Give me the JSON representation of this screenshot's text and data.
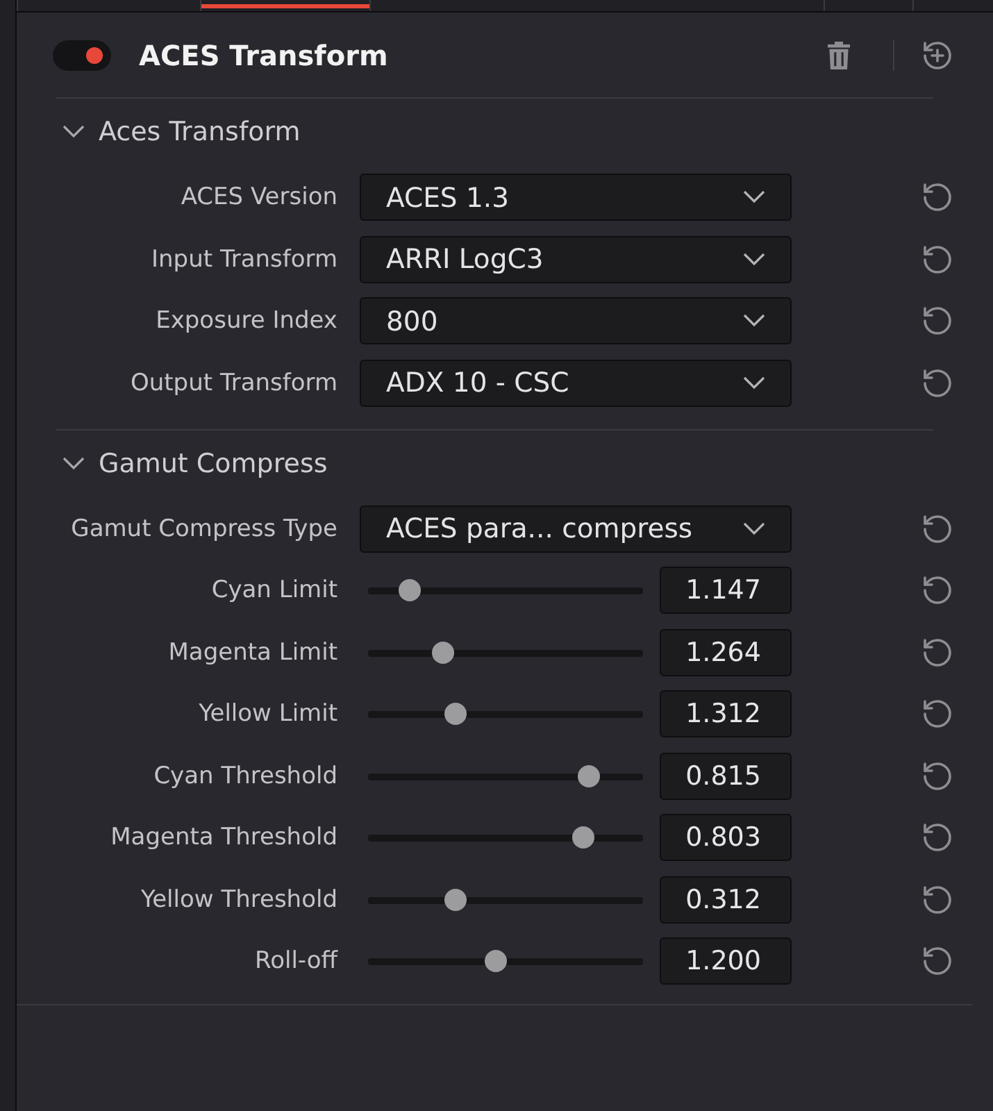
{
  "tab_bar": {
    "tabs": [
      {
        "selected": false
      },
      {
        "selected": true
      },
      {
        "selected": false
      },
      {
        "selected": false
      },
      {
        "selected": false
      }
    ]
  },
  "node": {
    "enabled": true,
    "title": "ACES Transform"
  },
  "sections": [
    {
      "title": "Aces Transform",
      "expanded": true,
      "rows": [
        {
          "kind": "dropdown",
          "label": "ACES Version",
          "value": "ACES 1.3"
        },
        {
          "kind": "dropdown",
          "label": "Input Transform",
          "value": "ARRI LogC3"
        },
        {
          "kind": "dropdown",
          "label": "Exposure Index",
          "value": "800"
        },
        {
          "kind": "dropdown",
          "label": "Output Transform",
          "value": "ADX 10 - CSC"
        }
      ]
    },
    {
      "title": "Gamut Compress",
      "expanded": true,
      "rows": [
        {
          "kind": "dropdown",
          "label": "Gamut Compress Type",
          "value": "ACES para... compress"
        },
        {
          "kind": "slider",
          "label": "Cyan Limit",
          "level": 0.12,
          "value": "1.147"
        },
        {
          "kind": "slider",
          "label": "Magenta Limit",
          "level": 0.25,
          "value": "1.264"
        },
        {
          "kind": "slider",
          "label": "Yellow Limit",
          "level": 0.3,
          "value": "1.312"
        },
        {
          "kind": "slider",
          "label": "Cyan Threshold",
          "level": 0.83,
          "value": "0.815"
        },
        {
          "kind": "slider",
          "label": "Magenta Threshold",
          "level": 0.81,
          "value": "0.803"
        },
        {
          "kind": "slider",
          "label": "Yellow Threshold",
          "level": 0.3,
          "value": "0.312"
        },
        {
          "kind": "slider",
          "label": "Roll-off",
          "level": 0.46,
          "value": "1.200"
        }
      ]
    }
  ]
}
